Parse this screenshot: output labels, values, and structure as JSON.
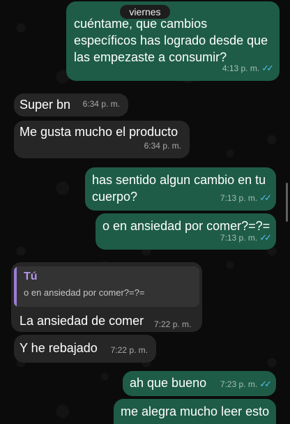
{
  "date_label": "viernes",
  "colors": {
    "outgoing_bubble": "#1e5c47",
    "incoming_bubble": "#262626",
    "read_ticks": "#53bdeb",
    "quote_bar": "#9b7ed4"
  },
  "messages": [
    {
      "direction": "outgoing",
      "text": "cuéntame, que cambios específicos has logrado desde que las empezaste a consumir?",
      "time": "4:13 p. m.",
      "status_icon": "double-check-read-icon"
    },
    {
      "direction": "incoming",
      "text": "Super bn",
      "time": "6:34 p. m."
    },
    {
      "direction": "incoming",
      "text": "Me gusta mucho el producto",
      "time": "6:34 p. m."
    },
    {
      "direction": "outgoing",
      "text": "has sentido algun cambio en tu cuerpo?",
      "time": "7:13 p. m.",
      "status_icon": "double-check-read-icon"
    },
    {
      "direction": "outgoing",
      "text": "o en ansiedad por comer?=?=",
      "time": "7:13 p. m.",
      "status_icon": "double-check-read-icon"
    },
    {
      "direction": "incoming",
      "quote_author": "Tú",
      "quote_text": "o en ansiedad por comer?=?=",
      "text": "La ansiedad de comer",
      "time": "7:22 p. m."
    },
    {
      "direction": "incoming",
      "text": "Y he rebajado",
      "time": "7:22 p. m."
    },
    {
      "direction": "outgoing",
      "text": "ah que bueno",
      "time": "7:23 p. m.",
      "status_icon": "double-check-read-icon"
    },
    {
      "direction": "outgoing",
      "text": "me alegra mucho leer esto",
      "time": "",
      "status_icon": ""
    }
  ]
}
